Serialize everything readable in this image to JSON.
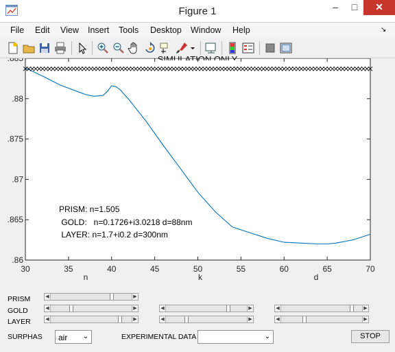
{
  "window": {
    "title": "Figure 1",
    "minimize": "–",
    "maximize": "□",
    "close": "✕"
  },
  "menu": [
    "File",
    "Edit",
    "View",
    "Insert",
    "Tools",
    "Desktop",
    "Window",
    "Help"
  ],
  "toolbar_icons": [
    "new-figure-icon",
    "open-file-icon",
    "save-icon",
    "print-icon",
    "pointer-icon",
    "zoom-in-icon",
    "zoom-out-icon",
    "pan-icon",
    "rotate-icon",
    "data-cursor-icon",
    "brush-icon",
    "brush-dropdown-icon",
    "link-plot-icon",
    "colorbar-icon",
    "legend-icon",
    "hide-plot-tools-icon",
    "show-plot-tools-icon"
  ],
  "plot": {
    "title": "SIMULATION ONLY"
  },
  "chart_data": {
    "type": "line",
    "title": "SIMULATION ONLY",
    "xlim": [
      30,
      70
    ],
    "ylim": [
      0.86,
      0.885
    ],
    "x_ticks": [
      "30",
      "35",
      "40",
      "45",
      "50",
      "55",
      "60",
      "65",
      "70"
    ],
    "y_ticks": [
      ".885",
      ".88",
      ".875",
      ".87",
      ".865",
      ".86"
    ],
    "y_tick_values": [
      0.885,
      0.88,
      0.875,
      0.87,
      0.865,
      0.86
    ],
    "xlabels_partial": [
      "n",
      "k",
      "d"
    ],
    "series": [
      {
        "style": "line",
        "color": "#0072bd",
        "x": [
          30,
          32,
          34,
          35,
          36,
          37,
          38,
          39,
          39.5,
          40,
          40.5,
          41,
          42,
          44,
          46,
          48,
          50,
          52,
          54,
          56,
          58,
          60,
          62,
          64,
          65,
          66,
          68,
          70
        ],
        "y": [
          0.8838,
          0.8828,
          0.8817,
          0.8813,
          0.8809,
          0.8805,
          0.8803,
          0.8804,
          0.8809,
          0.8816,
          0.8815,
          0.8811,
          0.8799,
          0.8772,
          0.8742,
          0.8713,
          0.8684,
          0.866,
          0.8641,
          0.8634,
          0.8627,
          0.8622,
          0.8621,
          0.862,
          0.862,
          0.8621,
          0.8625,
          0.8632
        ]
      },
      {
        "style": "markers",
        "marker": "x",
        "color": "#000000",
        "x_start": 30,
        "x_end": 70,
        "x_step": 0.4,
        "y": 0.8837
      }
    ],
    "grid": false
  },
  "annotations": [
    "PRISM: n=1.505",
    " GOLD:   n=0.1726+i3.0218 d=88nm",
    " LAYER: n=1.7+i0.2 d=300nm"
  ],
  "controls": {
    "labels": [
      "PRISM",
      "GOLD",
      "LAYER"
    ],
    "surphas_label": "SURPHAS",
    "surphas_value": "air",
    "experimental_label": "EXPERIMENTAL DATA",
    "experimental_value": "",
    "stop_label": "STOP",
    "arrow_left": "◀",
    "arrow_right": "▶",
    "chevron": "⌄"
  },
  "colors": {
    "line": "#0072bd",
    "close_button": "#c7352b"
  }
}
